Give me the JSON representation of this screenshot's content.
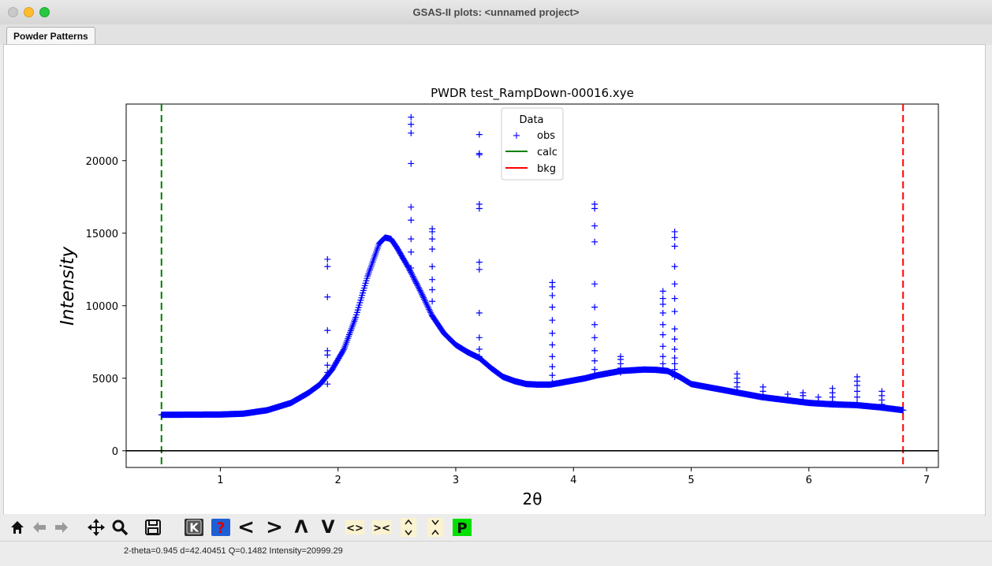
{
  "window": {
    "title": "GSAS-II plots: <unnamed project>"
  },
  "tabs": [
    {
      "label": "Powder Patterns"
    }
  ],
  "status": {
    "text": "2-theta=0.945 d=42.40451 Q=0.1482 Intensity=20999.29"
  },
  "toolbar": {
    "icons": [
      "home-icon",
      "back-icon",
      "forward-icon",
      "pan-icon",
      "zoom-icon",
      "save-icon",
      "k-key-icon",
      "help-icon",
      "shift-left-icon",
      "shift-right-icon",
      "shift-up-icon",
      "shift-down-icon",
      "expand-x-icon",
      "shrink-x-icon",
      "expand-y-icon",
      "shrink-y-icon",
      "p-key-icon"
    ],
    "k_label": "K",
    "help_label": "?",
    "p_label": "P",
    "lt": "<",
    "gt": ">",
    "up": "Λ",
    "down": "V",
    "expand_x": "<>",
    "shrink_x": "><"
  },
  "chart_data": {
    "type": "scatter",
    "title": "PWDR test_RampDown-00016.xye",
    "xlabel": "2θ",
    "ylabel": "Intensity",
    "xlim": [
      0.2,
      7.1
    ],
    "ylim": [
      -1150,
      23900
    ],
    "xticks": [
      1,
      2,
      3,
      4,
      5,
      6,
      7
    ],
    "yticks": [
      0,
      5000,
      10000,
      15000,
      20000
    ],
    "colors": {
      "obs": "#0000ff",
      "calc": "#008000",
      "bkg": "#ff0000"
    },
    "limits": {
      "lower": 0.5,
      "upper": 6.8
    },
    "legend": {
      "title": "Data",
      "placement": "top-center",
      "entries": [
        "obs",
        "calc",
        "bkg"
      ]
    },
    "zero_line": 0,
    "baseline_points": [
      [
        0.5,
        2480
      ],
      [
        1.0,
        2500
      ],
      [
        1.2,
        2560
      ],
      [
        1.4,
        2800
      ],
      [
        1.6,
        3300
      ],
      [
        1.75,
        4000
      ],
      [
        1.85,
        4600
      ],
      [
        1.95,
        5600
      ],
      [
        2.05,
        7000
      ],
      [
        2.15,
        9200
      ],
      [
        2.25,
        12000
      ],
      [
        2.35,
        14300
      ],
      [
        2.4,
        14700
      ],
      [
        2.45,
        14600
      ],
      [
        2.5,
        14000
      ],
      [
        2.6,
        12600
      ],
      [
        2.7,
        11000
      ],
      [
        2.8,
        9300
      ],
      [
        2.9,
        8100
      ],
      [
        3.0,
        7300
      ],
      [
        3.1,
        6800
      ],
      [
        3.2,
        6400
      ],
      [
        3.3,
        5700
      ],
      [
        3.4,
        5100
      ],
      [
        3.5,
        4800
      ],
      [
        3.6,
        4600
      ],
      [
        3.7,
        4560
      ],
      [
        3.8,
        4560
      ],
      [
        3.9,
        4700
      ],
      [
        4.0,
        4850
      ],
      [
        4.1,
        5000
      ],
      [
        4.2,
        5200
      ],
      [
        4.3,
        5350
      ],
      [
        4.4,
        5500
      ],
      [
        4.5,
        5550
      ],
      [
        4.6,
        5600
      ],
      [
        4.7,
        5580
      ],
      [
        4.8,
        5500
      ],
      [
        4.9,
        5100
      ],
      [
        5.0,
        4600
      ],
      [
        5.2,
        4300
      ],
      [
        5.4,
        4000
      ],
      [
        5.6,
        3700
      ],
      [
        5.8,
        3500
      ],
      [
        6.0,
        3300
      ],
      [
        6.2,
        3200
      ],
      [
        6.4,
        3150
      ],
      [
        6.6,
        3000
      ],
      [
        6.8,
        2800
      ]
    ],
    "peaks": [
      {
        "x": 1.91,
        "values": [
          4600,
          5400,
          5900,
          6600,
          6900,
          8300,
          10600,
          12700,
          13200
        ]
      },
      {
        "x": 2.62,
        "values": [
          12600,
          13700,
          14600,
          15900,
          16800,
          19800,
          21900,
          22500,
          23000
        ]
      },
      {
        "x": 2.8,
        "values": [
          9300,
          10300,
          11100,
          11800,
          12700,
          13900,
          14600,
          15100,
          15300
        ]
      },
      {
        "x": 3.2,
        "values": [
          6500,
          7000,
          7800,
          9500,
          12500,
          13000,
          16700,
          17000,
          20400,
          20500,
          21800
        ]
      },
      {
        "x": 3.82,
        "values": [
          4700,
          5200,
          5800,
          6500,
          7300,
          8100,
          9000,
          9900,
          10700,
          11300,
          11600
        ]
      },
      {
        "x": 4.18,
        "values": [
          5300,
          5600,
          6200,
          6900,
          7800,
          8700,
          9900,
          11500,
          14400,
          15500,
          16700,
          17000
        ]
      },
      {
        "x": 4.4,
        "values": [
          5400,
          5700,
          6000,
          6300,
          6500
        ]
      },
      {
        "x": 4.76,
        "values": [
          5600,
          6000,
          6500,
          7200,
          8000,
          8700,
          9500,
          10100,
          10500,
          11000
        ]
      },
      {
        "x": 4.86,
        "values": [
          5100,
          5600,
          6000,
          6400,
          7000,
          7700,
          8400,
          9600,
          10500,
          11500,
          12700,
          14100,
          14700,
          15100
        ]
      },
      {
        "x": 5.39,
        "values": [
          4100,
          4400,
          4700,
          5000,
          5300
        ]
      },
      {
        "x": 5.61,
        "values": [
          3800,
          4100,
          4400
        ]
      },
      {
        "x": 5.82,
        "values": [
          3600,
          3900
        ]
      },
      {
        "x": 5.95,
        "values": [
          3500,
          3800,
          4000
        ]
      },
      {
        "x": 6.08,
        "values": [
          3400,
          3700
        ]
      },
      {
        "x": 6.2,
        "values": [
          3400,
          3700,
          4000,
          4300
        ]
      },
      {
        "x": 6.41,
        "values": [
          3300,
          3700,
          4100,
          4500,
          4800,
          5100
        ]
      },
      {
        "x": 6.62,
        "values": [
          3200,
          3500,
          3800,
          4100
        ]
      }
    ]
  }
}
